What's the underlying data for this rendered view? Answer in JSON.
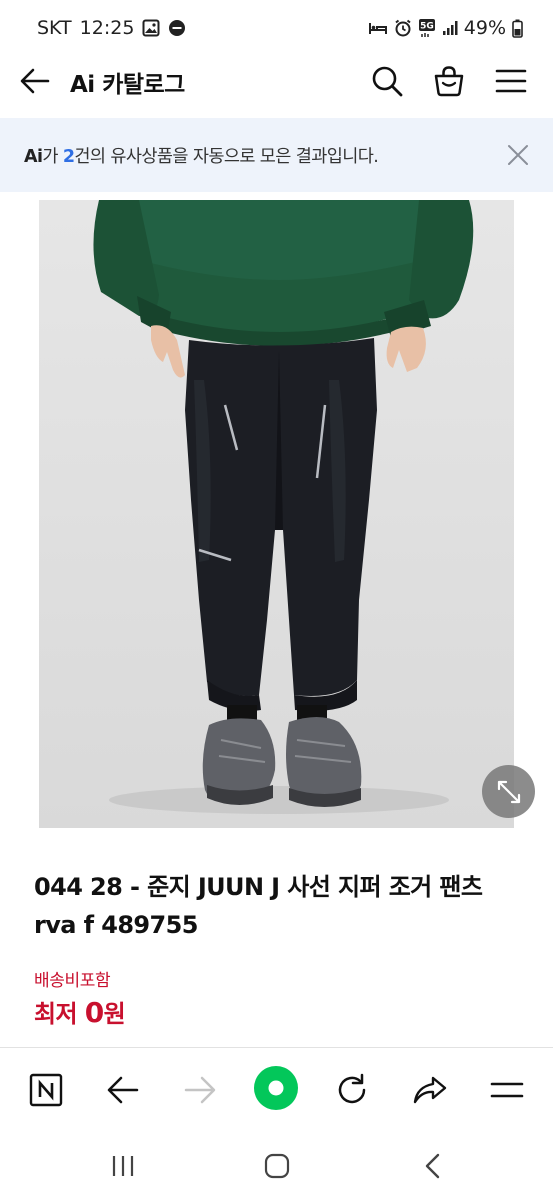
{
  "status_bar": {
    "carrier": "SKT",
    "time": "12:25",
    "network": "5G",
    "battery": "49%"
  },
  "header": {
    "title": "Ai 카탈로그"
  },
  "notice": {
    "ai": "Ai",
    "prefix": "가 ",
    "count": "2",
    "suffix": "건의 유사상품을 자동으로 모은 결과입니다."
  },
  "product": {
    "title": "044 28 - 준지 JUUN J 사선 지퍼 조거 팬츠 rva f 489755",
    "shipping": "배송비포함",
    "price_label": "최저 ",
    "price_value": "0",
    "price_unit": "원"
  },
  "colors": {
    "accent_red": "#c8102e",
    "accent_blue": "#2f6fe4",
    "naver_green": "#03c75a",
    "banner_bg": "#eef3fb"
  },
  "icons": {
    "back": "arrow-left-icon",
    "search": "search-icon",
    "cart": "cart-icon",
    "menu": "hamburger-icon",
    "close": "close-icon",
    "expand": "expand-icon",
    "naver": "naver-n-icon",
    "browser_back": "arrow-left-icon",
    "browser_forward": "arrow-right-icon",
    "home": "green-dot-icon",
    "refresh": "refresh-icon",
    "share": "share-icon",
    "browser_menu": "menu-icon",
    "recents": "recents-icon",
    "home_nav": "home-icon",
    "back_nav": "chevron-left-icon"
  }
}
